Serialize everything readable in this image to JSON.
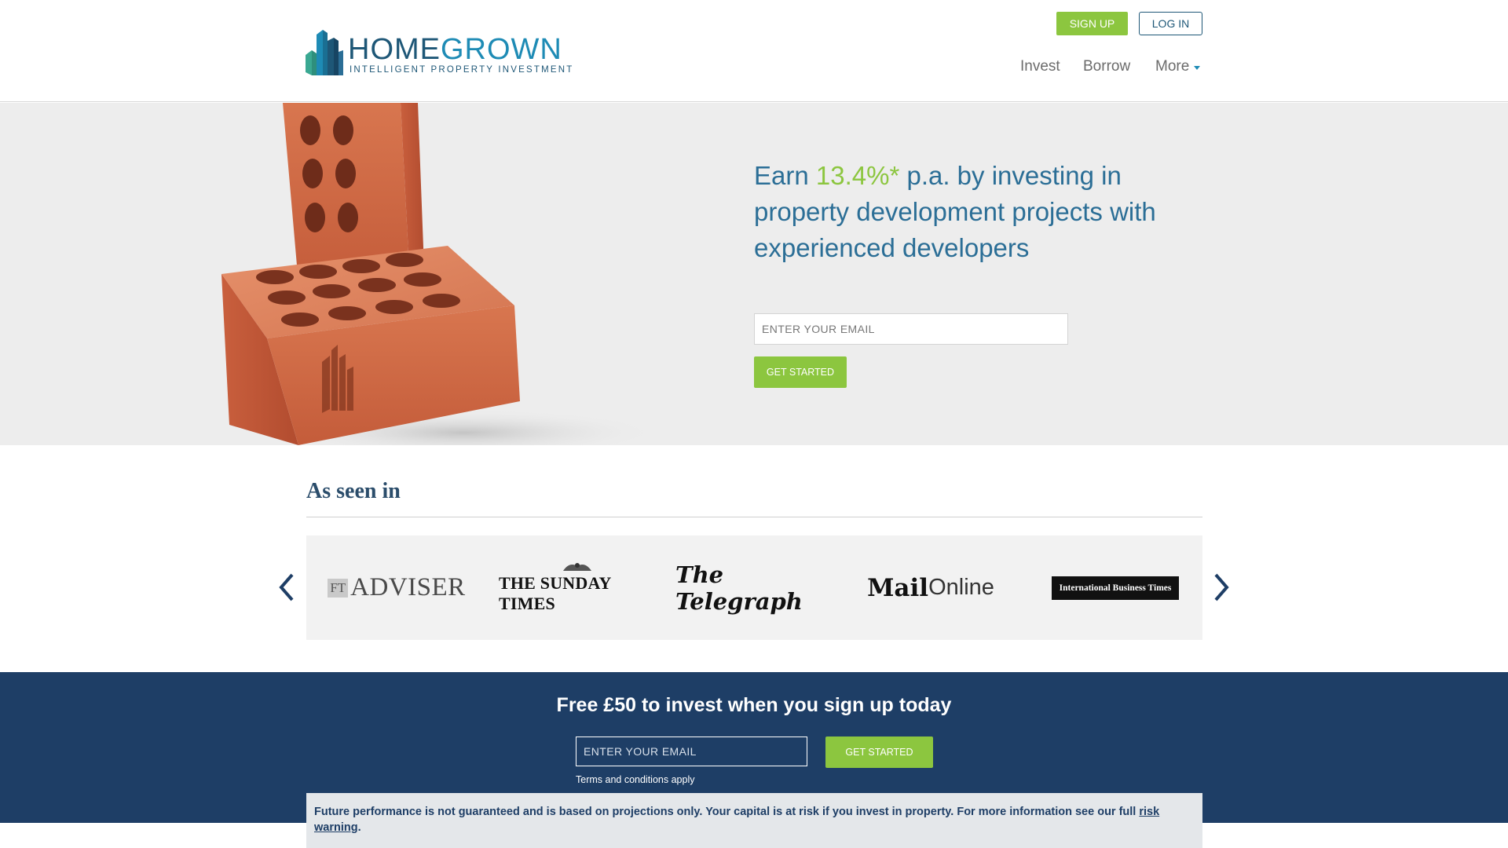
{
  "colors": {
    "primary_navy": "#1e3e66",
    "brand_blue": "#1e5777",
    "accent_blue": "#2b6e96",
    "accent_green": "#8cc63f",
    "hero_bg": "#ededed"
  },
  "header": {
    "logo_text_home": "HOME",
    "logo_text_grown": "GROWN",
    "logo_tagline": "INTELLIGENT PROPERTY INVESTMENT",
    "signup_label": "SIGN UP",
    "login_label": "LOG IN",
    "nav": {
      "invest": "Invest",
      "borrow": "Borrow",
      "more": "More"
    }
  },
  "hero": {
    "headline_prefix": "Earn ",
    "headline_rate": "13.4%*",
    "headline_suffix": " p.a. by investing in property development projects with experienced developers",
    "email_placeholder": "ENTER YOUR EMAIL",
    "cta_label": "GET STARTED"
  },
  "press": {
    "title": "As seen in",
    "logos": {
      "adviser_prefix": "FT",
      "adviser_name": "ADVISER",
      "sunday_times": "THE SUNDAY TIMES",
      "telegraph": "The Telegraph",
      "mail_bold": "Mail",
      "mail_light": "Online",
      "ibt": "International Business Times"
    },
    "prev_icon": "chevron-left-icon",
    "next_icon": "chevron-right-icon"
  },
  "banner": {
    "title": "Free £50 to invest when you sign up today",
    "email_placeholder": "ENTER YOUR EMAIL",
    "cta_label": "GET STARTED",
    "terms": "Terms and conditions apply"
  },
  "risk": {
    "text": "Future performance is not guaranteed and is based on projections only. Your capital is at risk if you invest in property. For more information see our full ",
    "link": "risk warning",
    "end": "."
  }
}
